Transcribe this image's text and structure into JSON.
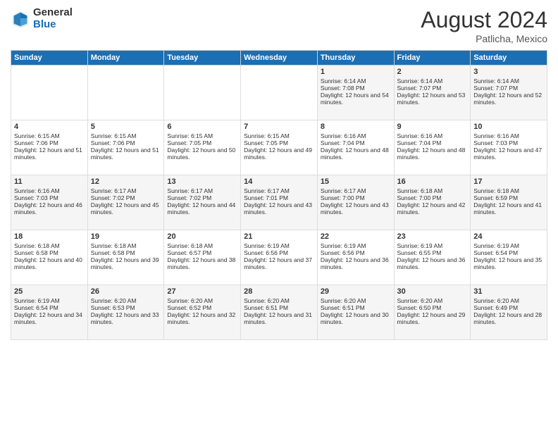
{
  "header": {
    "logo_general": "General",
    "logo_blue": "Blue",
    "month_year": "August 2024",
    "location": "Patlicha, Mexico"
  },
  "days_of_week": [
    "Sunday",
    "Monday",
    "Tuesday",
    "Wednesday",
    "Thursday",
    "Friday",
    "Saturday"
  ],
  "weeks": [
    [
      {
        "day": "",
        "data": ""
      },
      {
        "day": "",
        "data": ""
      },
      {
        "day": "",
        "data": ""
      },
      {
        "day": "",
        "data": ""
      },
      {
        "day": "1",
        "sunrise": "Sunrise: 6:14 AM",
        "sunset": "Sunset: 7:08 PM",
        "daylight": "Daylight: 12 hours and 54 minutes."
      },
      {
        "day": "2",
        "sunrise": "Sunrise: 6:14 AM",
        "sunset": "Sunset: 7:07 PM",
        "daylight": "Daylight: 12 hours and 53 minutes."
      },
      {
        "day": "3",
        "sunrise": "Sunrise: 6:14 AM",
        "sunset": "Sunset: 7:07 PM",
        "daylight": "Daylight: 12 hours and 52 minutes."
      }
    ],
    [
      {
        "day": "4",
        "sunrise": "Sunrise: 6:15 AM",
        "sunset": "Sunset: 7:06 PM",
        "daylight": "Daylight: 12 hours and 51 minutes."
      },
      {
        "day": "5",
        "sunrise": "Sunrise: 6:15 AM",
        "sunset": "Sunset: 7:06 PM",
        "daylight": "Daylight: 12 hours and 51 minutes."
      },
      {
        "day": "6",
        "sunrise": "Sunrise: 6:15 AM",
        "sunset": "Sunset: 7:05 PM",
        "daylight": "Daylight: 12 hours and 50 minutes."
      },
      {
        "day": "7",
        "sunrise": "Sunrise: 6:15 AM",
        "sunset": "Sunset: 7:05 PM",
        "daylight": "Daylight: 12 hours and 49 minutes."
      },
      {
        "day": "8",
        "sunrise": "Sunrise: 6:16 AM",
        "sunset": "Sunset: 7:04 PM",
        "daylight": "Daylight: 12 hours and 48 minutes."
      },
      {
        "day": "9",
        "sunrise": "Sunrise: 6:16 AM",
        "sunset": "Sunset: 7:04 PM",
        "daylight": "Daylight: 12 hours and 48 minutes."
      },
      {
        "day": "10",
        "sunrise": "Sunrise: 6:16 AM",
        "sunset": "Sunset: 7:03 PM",
        "daylight": "Daylight: 12 hours and 47 minutes."
      }
    ],
    [
      {
        "day": "11",
        "sunrise": "Sunrise: 6:16 AM",
        "sunset": "Sunset: 7:03 PM",
        "daylight": "Daylight: 12 hours and 46 minutes."
      },
      {
        "day": "12",
        "sunrise": "Sunrise: 6:17 AM",
        "sunset": "Sunset: 7:02 PM",
        "daylight": "Daylight: 12 hours and 45 minutes."
      },
      {
        "day": "13",
        "sunrise": "Sunrise: 6:17 AM",
        "sunset": "Sunset: 7:02 PM",
        "daylight": "Daylight: 12 hours and 44 minutes."
      },
      {
        "day": "14",
        "sunrise": "Sunrise: 6:17 AM",
        "sunset": "Sunset: 7:01 PM",
        "daylight": "Daylight: 12 hours and 43 minutes."
      },
      {
        "day": "15",
        "sunrise": "Sunrise: 6:17 AM",
        "sunset": "Sunset: 7:00 PM",
        "daylight": "Daylight: 12 hours and 43 minutes."
      },
      {
        "day": "16",
        "sunrise": "Sunrise: 6:18 AM",
        "sunset": "Sunset: 7:00 PM",
        "daylight": "Daylight: 12 hours and 42 minutes."
      },
      {
        "day": "17",
        "sunrise": "Sunrise: 6:18 AM",
        "sunset": "Sunset: 6:59 PM",
        "daylight": "Daylight: 12 hours and 41 minutes."
      }
    ],
    [
      {
        "day": "18",
        "sunrise": "Sunrise: 6:18 AM",
        "sunset": "Sunset: 6:58 PM",
        "daylight": "Daylight: 12 hours and 40 minutes."
      },
      {
        "day": "19",
        "sunrise": "Sunrise: 6:18 AM",
        "sunset": "Sunset: 6:58 PM",
        "daylight": "Daylight: 12 hours and 39 minutes."
      },
      {
        "day": "20",
        "sunrise": "Sunrise: 6:18 AM",
        "sunset": "Sunset: 6:57 PM",
        "daylight": "Daylight: 12 hours and 38 minutes."
      },
      {
        "day": "21",
        "sunrise": "Sunrise: 6:19 AM",
        "sunset": "Sunset: 6:56 PM",
        "daylight": "Daylight: 12 hours and 37 minutes."
      },
      {
        "day": "22",
        "sunrise": "Sunrise: 6:19 AM",
        "sunset": "Sunset: 6:56 PM",
        "daylight": "Daylight: 12 hours and 36 minutes."
      },
      {
        "day": "23",
        "sunrise": "Sunrise: 6:19 AM",
        "sunset": "Sunset: 6:55 PM",
        "daylight": "Daylight: 12 hours and 36 minutes."
      },
      {
        "day": "24",
        "sunrise": "Sunrise: 6:19 AM",
        "sunset": "Sunset: 6:54 PM",
        "daylight": "Daylight: 12 hours and 35 minutes."
      }
    ],
    [
      {
        "day": "25",
        "sunrise": "Sunrise: 6:19 AM",
        "sunset": "Sunset: 6:54 PM",
        "daylight": "Daylight: 12 hours and 34 minutes."
      },
      {
        "day": "26",
        "sunrise": "Sunrise: 6:20 AM",
        "sunset": "Sunset: 6:53 PM",
        "daylight": "Daylight: 12 hours and 33 minutes."
      },
      {
        "day": "27",
        "sunrise": "Sunrise: 6:20 AM",
        "sunset": "Sunset: 6:52 PM",
        "daylight": "Daylight: 12 hours and 32 minutes."
      },
      {
        "day": "28",
        "sunrise": "Sunrise: 6:20 AM",
        "sunset": "Sunset: 6:51 PM",
        "daylight": "Daylight: 12 hours and 31 minutes."
      },
      {
        "day": "29",
        "sunrise": "Sunrise: 6:20 AM",
        "sunset": "Sunset: 6:51 PM",
        "daylight": "Daylight: 12 hours and 30 minutes."
      },
      {
        "day": "30",
        "sunrise": "Sunrise: 6:20 AM",
        "sunset": "Sunset: 6:50 PM",
        "daylight": "Daylight: 12 hours and 29 minutes."
      },
      {
        "day": "31",
        "sunrise": "Sunrise: 6:20 AM",
        "sunset": "Sunset: 6:49 PM",
        "daylight": "Daylight: 12 hours and 28 minutes."
      }
    ]
  ]
}
